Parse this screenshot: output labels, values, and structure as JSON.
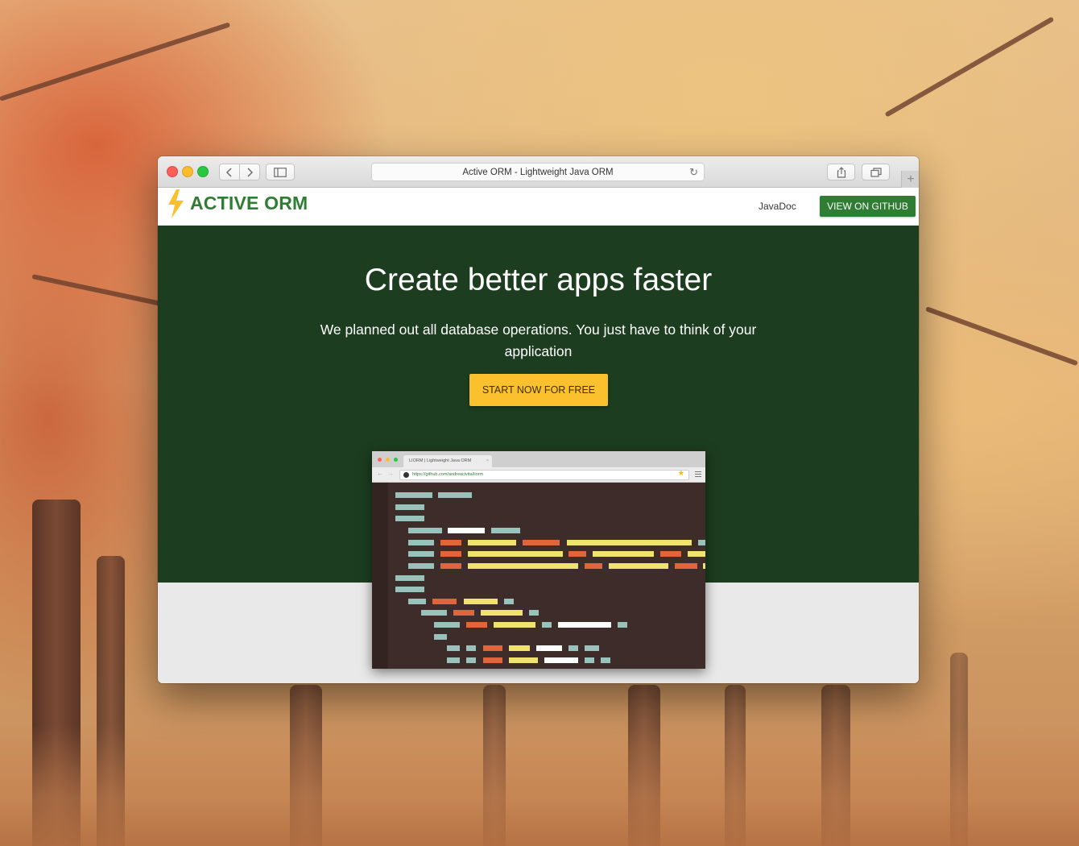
{
  "browser": {
    "address_text": "Active ORM - Lightweight Java ORM",
    "icons": {
      "back": "chevron-left-icon",
      "forward": "chevron-right-icon",
      "sidebar": "sidebar-icon",
      "reload": "reload-icon",
      "share": "share-icon",
      "tabs": "tabs-icon",
      "new_tab": "plus-icon"
    }
  },
  "site": {
    "logo_text": "ACTIVE ORM",
    "nav": {
      "javadoc": "JavaDoc",
      "github_button": "VIEW ON GITHUB"
    },
    "hero": {
      "title": "Create better apps faster",
      "subtitle": "We planned out all database operations. You just have to think of your application",
      "cta": "START NOW FOR FREE"
    },
    "colors": {
      "brand_green": "#2e7d32",
      "hero_bg": "#1c3d1f",
      "cta_yellow": "#fbc02d",
      "bolt_yellow": "#fbc02d"
    }
  },
  "preview": {
    "tab_title": "LIORM | Lightweight Java ORM",
    "url": "https://github.com/andreacivita/liorm"
  }
}
